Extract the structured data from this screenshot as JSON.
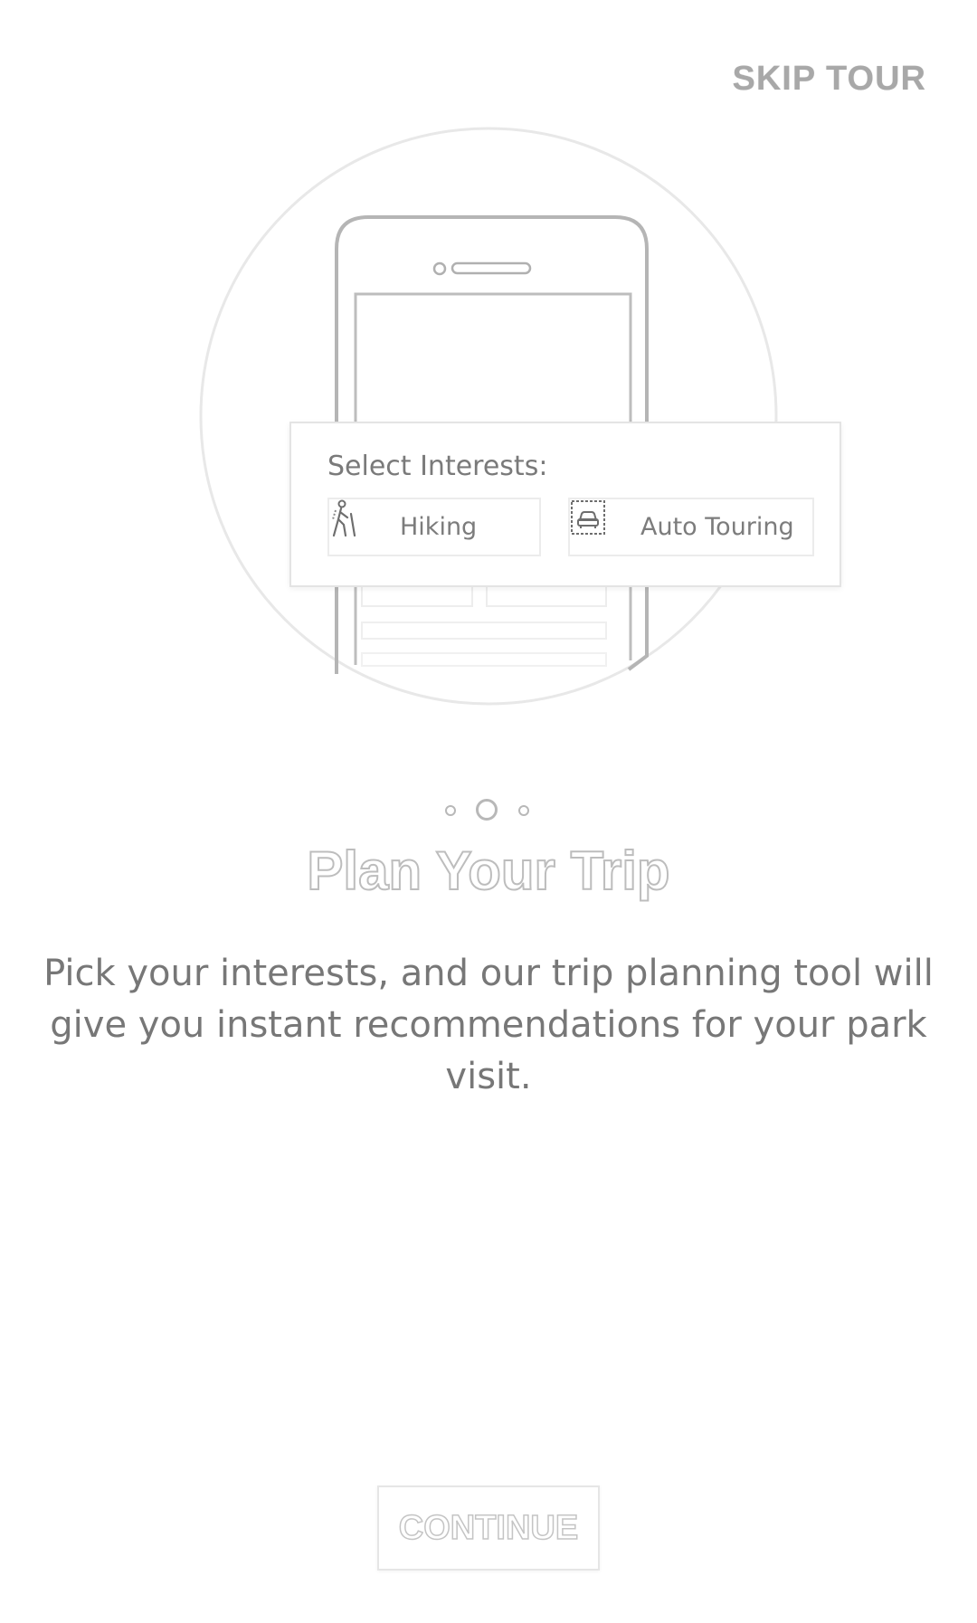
{
  "header": {
    "skip_label": "SKIP TOUR"
  },
  "illustration": {
    "card_title": "Select Interests:",
    "chips": [
      {
        "label": "Hiking",
        "icon": "hiker-icon"
      },
      {
        "label": "Auto Touring",
        "icon": "car-icon"
      }
    ]
  },
  "pager": {
    "total": 3,
    "active_index": 1
  },
  "content": {
    "title": "Plan Your Trip",
    "description": "Pick your interests, and our trip planning tool will give you instant recommendations for your park visit."
  },
  "footer": {
    "continue_label": "CONTINUE"
  },
  "colors": {
    "text": "#777777",
    "muted": "#bdbdbd",
    "background": "#ffffff"
  }
}
